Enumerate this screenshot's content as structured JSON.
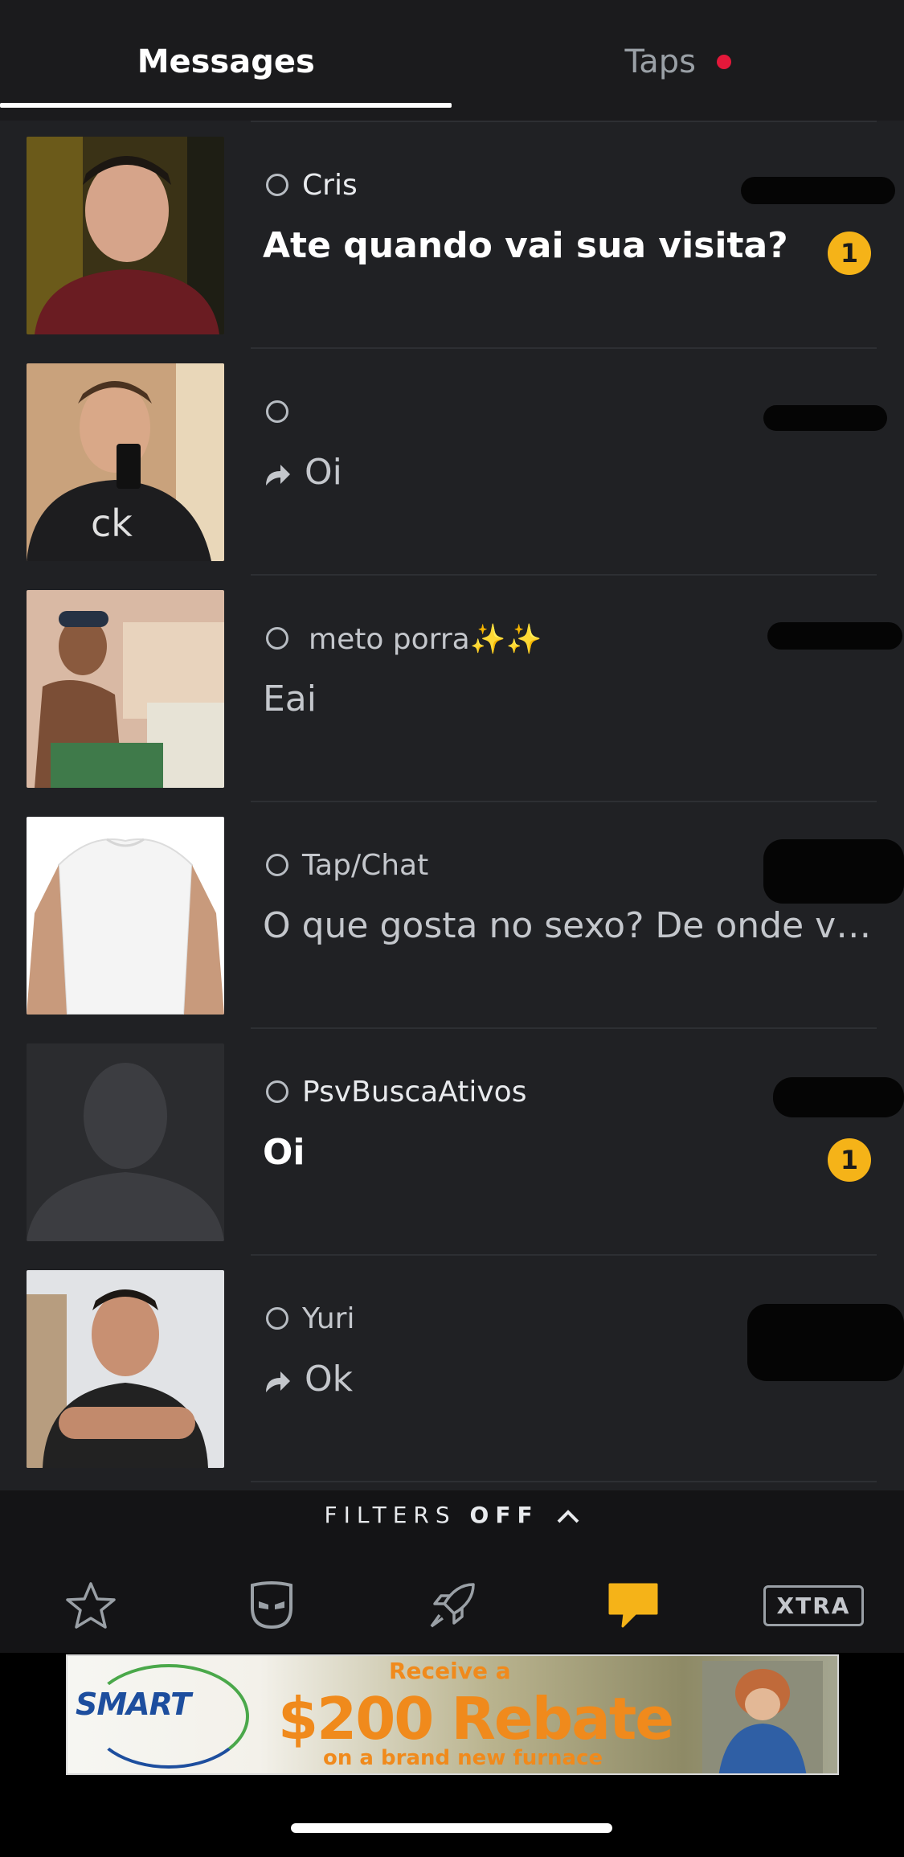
{
  "header": {
    "tab_messages": "Messages",
    "tab_taps": "Taps"
  },
  "conversations": [
    {
      "name": "Cris",
      "message": "Ate quando vai sua visita?",
      "unread_count": "1",
      "unread": true,
      "replied": false
    },
    {
      "name": "",
      "message": "Oi",
      "unread_count": "",
      "unread": false,
      "replied": true
    },
    {
      "name": "meto porra✨✨",
      "message": "Eai",
      "unread_count": "",
      "unread": false,
      "replied": false
    },
    {
      "name": "Tap/Chat",
      "message": "O que gosta no sexo? De onde voc...",
      "unread_count": "",
      "unread": false,
      "replied": false
    },
    {
      "name": "PsvBuscaAtivos",
      "message": "Oi",
      "unread_count": "1",
      "unread": true,
      "replied": false
    },
    {
      "name": "Yuri",
      "message": "Ok",
      "unread_count": "",
      "unread": false,
      "replied": true
    }
  ],
  "filters": {
    "label": "FILTERS",
    "state": "OFF"
  },
  "nav": {
    "items": [
      "favorites-icon",
      "grindr-mask-icon",
      "explore-rocket-icon",
      "messages-icon",
      "xtra-icon"
    ],
    "xtra_label": "XTRA",
    "active_color": "#f5b318"
  },
  "ad": {
    "logo": "SMART",
    "line1": "Receive a",
    "line2": "$200 Rebate",
    "line3": "on a brand new furnace"
  },
  "colors": {
    "background": "#202124",
    "badge": "#f5b318",
    "tab_dot": "#e4183a"
  }
}
